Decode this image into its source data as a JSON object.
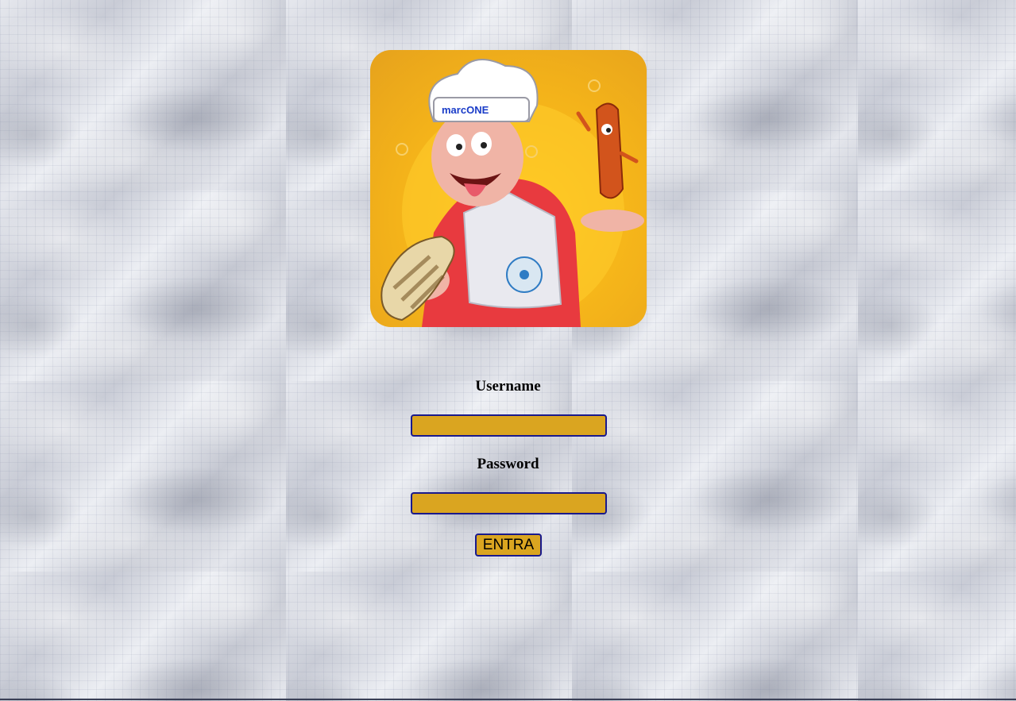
{
  "logo": {
    "brand_text": "marcONE",
    "icon": "chef-with-sausage-logo",
    "background_color": "#f4b31a"
  },
  "form": {
    "username_label": "Username",
    "username_value": "",
    "password_label": "Password",
    "password_value": "",
    "submit_label": "ENTRA",
    "field_color": "#daa520",
    "border_color": "#1a1a8c"
  }
}
